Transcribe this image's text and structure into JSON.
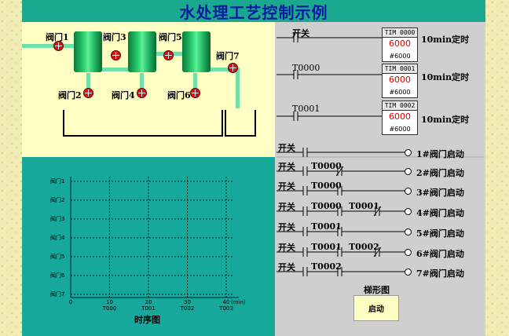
{
  "title": "水处理工艺控制示例",
  "process": {
    "valves": [
      "阀门1",
      "阀门2",
      "阀门3",
      "阀门4",
      "阀门5",
      "阀门6",
      "阀门7"
    ]
  },
  "timers": [
    {
      "name": "TIM 0000",
      "value": "6000",
      "set": "#6000",
      "desc": "10min定时"
    },
    {
      "name": "TIM 0001",
      "value": "6000",
      "set": "#6000",
      "desc": "10min定时"
    },
    {
      "name": "TIM 0002",
      "value": "6000",
      "set": "#6000",
      "desc": "10min定时"
    }
  ],
  "ladder": {
    "timer_rung_inputs": [
      "开关",
      "T0000",
      "T0001"
    ],
    "rungs": [
      {
        "contacts": [
          "开关"
        ],
        "coil": "1#阀门启动"
      },
      {
        "contacts": [
          "开关",
          "T0000"
        ],
        "coil": "2#阀门启动"
      },
      {
        "contacts": [
          "开关",
          "T0000"
        ],
        "coil": "3#阀门启动"
      },
      {
        "contacts": [
          "开关",
          "T0000",
          "T0001"
        ],
        "coil": "4#阀门启动"
      },
      {
        "contacts": [
          "开关",
          "T0001"
        ],
        "coil": "5#阀门启动"
      },
      {
        "contacts": [
          "开关",
          "T0001",
          "T0002"
        ],
        "coil": "6#阀门启动"
      },
      {
        "contacts": [
          "开关",
          "T0002"
        ],
        "coil": "7#阀门启动"
      }
    ],
    "caption": "梯形图",
    "start_label": "启动"
  },
  "timing": {
    "caption": "时序图",
    "y_labels": [
      "阀门1",
      "阀门2",
      "阀门3",
      "阀门4",
      "阀门5",
      "阀门6",
      "阀门7"
    ],
    "x_ticks": [
      "0",
      "10",
      "20",
      "30",
      "40"
    ],
    "x_sublabels": [
      "",
      "T000",
      "T001",
      "T002",
      "T003"
    ],
    "x_unit": "(min)"
  }
}
